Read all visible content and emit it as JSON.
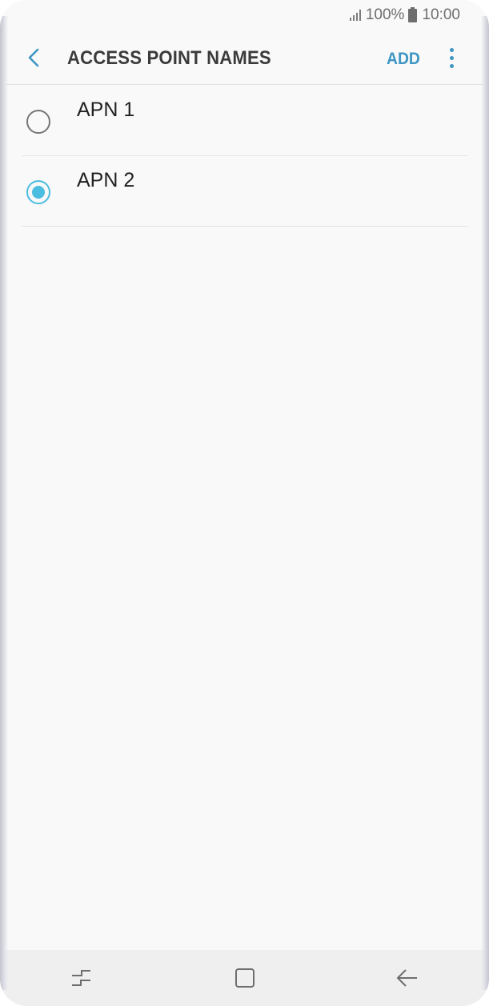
{
  "status_bar": {
    "battery": "100%",
    "time": "10:00",
    "icons": [
      "signal-icon",
      "battery-icon"
    ]
  },
  "action_bar": {
    "back_icon": "back-chevron-icon",
    "title": "ACCESS POINT NAMES",
    "add_label": "ADD",
    "more_icon": "more-vertical-icon"
  },
  "apns": [
    {
      "name": "APN 1",
      "selected": false
    },
    {
      "name": "APN 2",
      "selected": true
    }
  ],
  "nav_bar": {
    "recents_icon": "recent-apps-icon",
    "home_icon": "home-icon",
    "back_icon": "back-arrow-icon"
  },
  "colors": {
    "accent": "#3e96c2",
    "radio_selected": "#4bbde0",
    "title_text": "#3b3b3b",
    "background": "#f9f9f9"
  }
}
